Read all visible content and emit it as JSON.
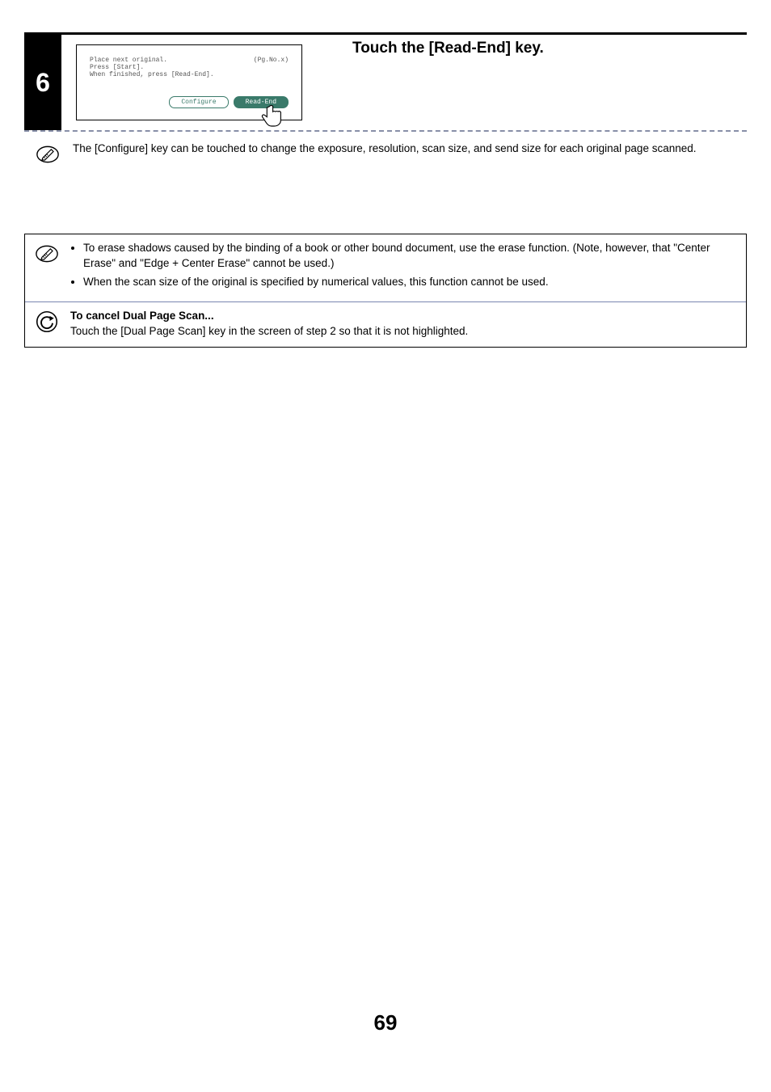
{
  "step": {
    "number": "6",
    "title": "Touch the [Read-End] key.",
    "screen": {
      "line1_left": "Place next original.",
      "line1_right": "(Pg.No.x)",
      "line2": "Press [Start].",
      "line3": "When finished, press [Read-End].",
      "btn_configure": "Configure",
      "btn_readend": "Read-End"
    },
    "hint": "The [Configure] key can be touched to change the exposure, resolution, scan size, and send size for each original page scanned."
  },
  "notes": {
    "bullets": [
      "To erase shadows caused by the binding of a book or other bound document, use the erase function. (Note, however, that \"Center Erase\" and \"Edge + Center Erase\" cannot be used.)",
      "When the scan size of the original is specified by numerical values, this function cannot be used."
    ],
    "cancel_title": "To cancel Dual Page Scan...",
    "cancel_text": "Touch the [Dual Page Scan] key in the screen of step 2 so that it is not highlighted."
  },
  "page_number": "69"
}
